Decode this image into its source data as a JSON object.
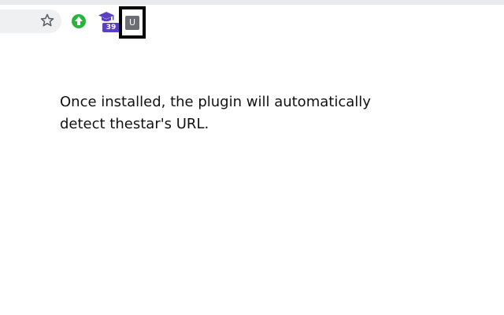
{
  "toolbar": {
    "bookmark_icon": "star-icon",
    "extensions": [
      {
        "icon": "green-arrow-icon",
        "color": "#28b43c"
      },
      {
        "icon": "graduation-cap-icon",
        "color": "#5b3fc4",
        "badge": "39"
      },
      {
        "icon": "u-extension-icon",
        "label": "U",
        "color": "#6b6e73",
        "highlighted": true
      }
    ]
  },
  "content": {
    "instruction_line1": "Once installed, the plugin will automatically",
    "instruction_line2": "detect thestar's URL."
  }
}
